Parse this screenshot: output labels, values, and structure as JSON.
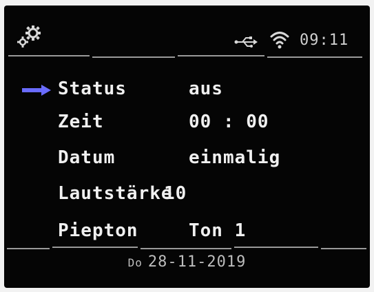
{
  "statusbar": {
    "settings_icon": "gear-icon",
    "usb_icon": "usb-icon",
    "wifi_icon": "wifi-icon",
    "time": "09:11"
  },
  "menu": {
    "selected_index": 0,
    "items": [
      {
        "label": "Status",
        "value": "aus"
      },
      {
        "label": "Zeit",
        "value": "00 : 00"
      },
      {
        "label": "Datum",
        "value": "einmalig"
      },
      {
        "label": "Lautstärke",
        "value": "10"
      },
      {
        "label": "Piepton",
        "value": "Ton 1"
      }
    ]
  },
  "footer": {
    "day": "Do",
    "date": "28-11-2019"
  },
  "colors": {
    "background": "#050505",
    "text": "#f0f0f0",
    "selection_arrow": "#6a6cff"
  }
}
